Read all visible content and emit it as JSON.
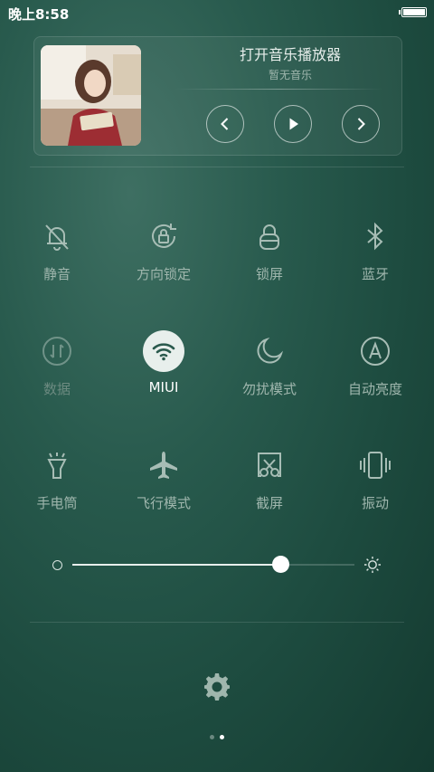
{
  "status_bar": {
    "time": "晚上8:58",
    "battery_level": 1.0
  },
  "music": {
    "title": "打开音乐播放器",
    "subtitle": "暂无音乐",
    "album_icon": "album-photo",
    "controls": [
      "previous-icon",
      "play-icon",
      "next-icon"
    ]
  },
  "toggles": [
    {
      "label": "静音",
      "icon": "bell-off-icon",
      "state": "off"
    },
    {
      "label": "方向锁定",
      "icon": "rotation-lock-icon",
      "state": "off"
    },
    {
      "label": "锁屏",
      "icon": "lock-icon",
      "state": "off"
    },
    {
      "label": "蓝牙",
      "icon": "bluetooth-icon",
      "state": "off"
    },
    {
      "label": "数据",
      "icon": "mobile-data-icon",
      "state": "disabled"
    },
    {
      "label": "MIUI",
      "icon": "wifi-icon",
      "state": "on"
    },
    {
      "label": "勿扰模式",
      "icon": "moon-icon",
      "state": "off"
    },
    {
      "label": "自动亮度",
      "icon": "auto-brightness-icon",
      "state": "off"
    },
    {
      "label": "手电筒",
      "icon": "flashlight-icon",
      "state": "off"
    },
    {
      "label": "飞行模式",
      "icon": "airplane-icon",
      "state": "off"
    },
    {
      "label": "截屏",
      "icon": "screenshot-icon",
      "state": "off"
    },
    {
      "label": "振动",
      "icon": "vibrate-icon",
      "state": "off"
    }
  ],
  "brightness": {
    "level": 0.74
  },
  "settings": {
    "icon": "gear-icon"
  },
  "pager": {
    "count": 2,
    "active": 1
  },
  "colors": {
    "accent": "#e8efec",
    "bg": "#1d4b3f",
    "label": "#9fb6ad",
    "label_dim": "#6c8a80"
  }
}
